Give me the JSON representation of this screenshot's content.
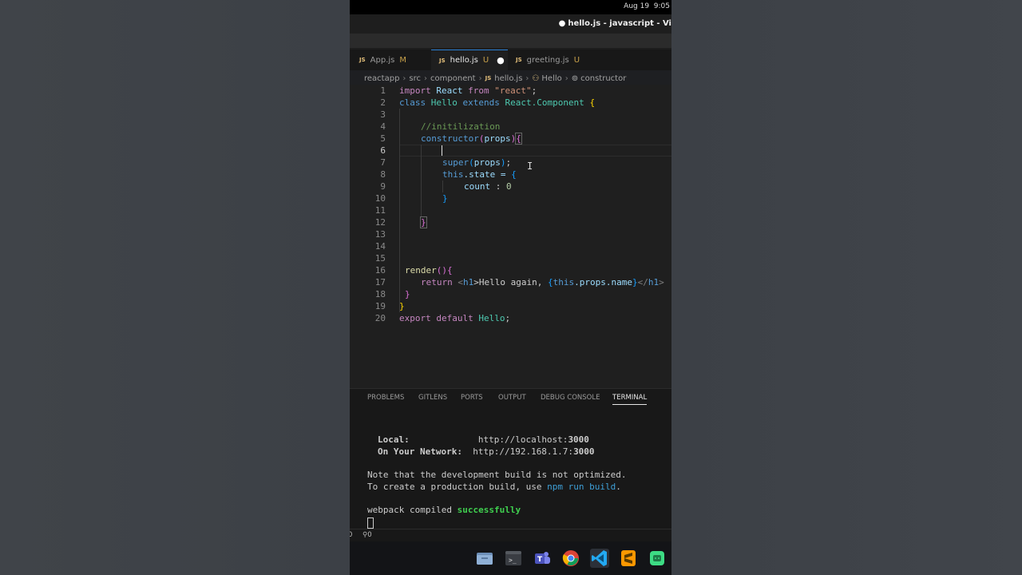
{
  "system": {
    "date": "Aug 19",
    "time": "9:05"
  },
  "window": {
    "title": "hello.js - javascript - Vi"
  },
  "tabs": [
    {
      "label": "App.js",
      "badge": "M",
      "active": false
    },
    {
      "label": "hello.js",
      "badge": "U",
      "active": true,
      "modified": true
    },
    {
      "label": "greeting.js",
      "badge": "U",
      "active": false
    }
  ],
  "breadcrumb": {
    "items": [
      "reactapp",
      "src",
      "component",
      "hello.js",
      "Hello",
      "constructor"
    ]
  },
  "editor": {
    "line_numbers": [
      "1",
      "2",
      "3",
      "4",
      "5",
      "6",
      "7",
      "8",
      "9",
      "10",
      "11",
      "12",
      "13",
      "14",
      "15",
      "16",
      "17",
      "18",
      "19",
      "20"
    ],
    "current_line": 6,
    "lines": {
      "l1": {
        "a": "import",
        "b": " React ",
        "c": "from",
        "d": " \"react\"",
        "e": ";"
      },
      "l2": {
        "a": "class",
        "b": " Hello ",
        "c": "extends",
        "d": " React.Component ",
        "e": "{"
      },
      "l4": {
        "a": "//initilization"
      },
      "l5": {
        "a": "constructor",
        "b": "(",
        "c": "props",
        "d": ")",
        "e": "{"
      },
      "l7": {
        "a": "super",
        "b": "(",
        "c": "props",
        "d": ")",
        "e": ";"
      },
      "l8": {
        "a": "this",
        "b": ".state = ",
        "c": "{"
      },
      "l9": {
        "a": "count",
        "b": " : ",
        "c": "0"
      },
      "l10": {
        "a": "}"
      },
      "l12": {
        "a": "}"
      },
      "l16": {
        "a": "render",
        "b": "(){"
      },
      "l17": {
        "a": "return",
        "b": " <",
        "c": "h1",
        "d": ">Hello again, ",
        "e": "{",
        "f": "this",
        "g": ".props.name",
        "h": "}",
        "i": "</",
        "j": "h1",
        "k": ">"
      },
      "l18": {
        "a": "}"
      },
      "l19": {
        "a": "}"
      },
      "l20": {
        "a": "export",
        "b": " default",
        "c": " Hello",
        "d": ";"
      }
    }
  },
  "panel": {
    "tabs": [
      "PROBLEMS",
      "GITLENS",
      "PORTS",
      "OUTPUT",
      "DEBUG CONSOLE",
      "TERMINAL"
    ],
    "active_tab": "TERMINAL"
  },
  "terminal": {
    "local_label": "Local:",
    "local_url_pre": "http://localhost:",
    "local_port": "3000",
    "network_label": "On Your Network:",
    "network_url_pre": "http://192.168.1.7:",
    "network_port": "3000",
    "note1": "Note that the development build is not optimized.",
    "note2_pre": "To create a production build, use ",
    "note2_cmd": "npm run build",
    "note2_post": ".",
    "compiled_pre": "webpack compiled ",
    "compiled_status": "successfully"
  },
  "statusbar": {
    "errors": "0",
    "ports": "0"
  },
  "dock": {
    "apps": [
      "files-icon",
      "terminal-icon",
      "teams-icon",
      "chrome-icon",
      "vscode-icon",
      "sublime-icon",
      "android-studio-icon"
    ]
  },
  "colors": {
    "accent": "#2a7fd4",
    "terminal_green": "#3fcf4f",
    "terminal_cyan": "#3ea0d8"
  }
}
